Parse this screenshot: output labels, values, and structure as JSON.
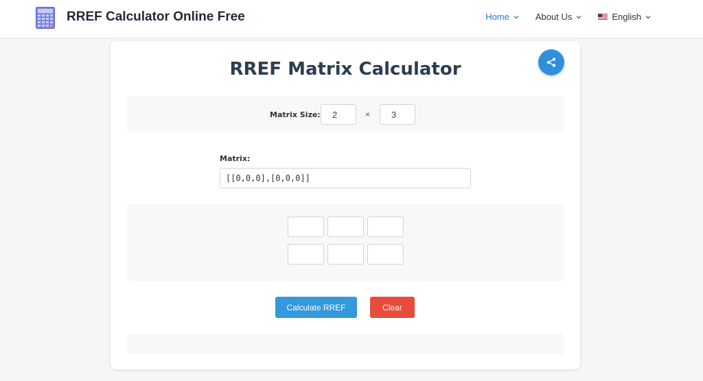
{
  "header": {
    "site_title": "RREF Calculator Online Free",
    "nav": [
      {
        "label": "Home"
      },
      {
        "label": "About Us"
      },
      {
        "label": "English"
      }
    ]
  },
  "main": {
    "title": "RREF Matrix Calculator",
    "size": {
      "label": "Matrix Size:",
      "rows": "2",
      "separator": "×",
      "cols": "3"
    },
    "matrix": {
      "label": "Matrix:",
      "text": "[[0,0,0],[0,0,0]]"
    },
    "cells": [
      "",
      "",
      "",
      "",
      "",
      ""
    ],
    "buttons": {
      "calculate": "Calculate RREF",
      "clear": "Clear"
    }
  },
  "colors": {
    "accent": "#3498db",
    "danger": "#e74c3c",
    "nav_active": "#2b78c2"
  },
  "icons": [
    "calculator-icon",
    "chevron-down-icon",
    "us-flag-icon",
    "share-icon"
  ]
}
